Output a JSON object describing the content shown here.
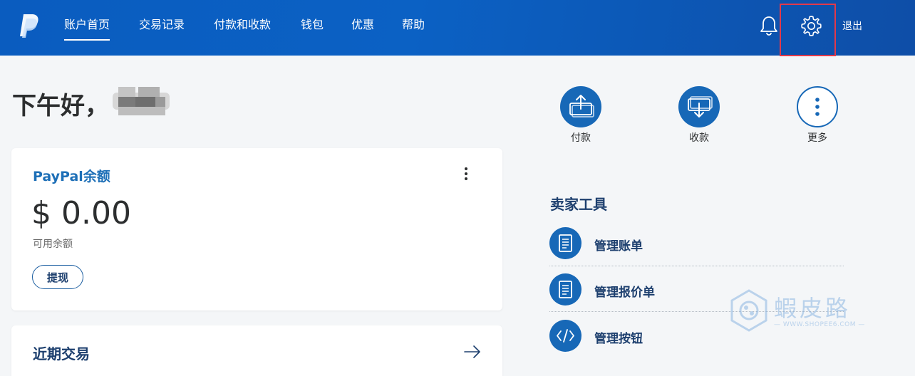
{
  "header": {
    "nav": [
      {
        "label": "账户首页",
        "active": true
      },
      {
        "label": "交易记录"
      },
      {
        "label": "付款和收款"
      },
      {
        "label": "钱包"
      },
      {
        "label": "优惠"
      },
      {
        "label": "帮助"
      }
    ],
    "logout_label": "退出"
  },
  "greeting": {
    "text": "下午好，"
  },
  "balance": {
    "title": "PayPal余额",
    "amount": "$ 0.00",
    "subtitle": "可用余额",
    "withdraw_label": "提现"
  },
  "quick_actions": [
    {
      "label": "付款",
      "icon": "send-money-icon"
    },
    {
      "label": "收款",
      "icon": "request-money-icon"
    },
    {
      "label": "更多",
      "icon": "more-vertical-icon"
    }
  ],
  "recent": {
    "title": "近期交易"
  },
  "seller_tools": {
    "title": "卖家工具",
    "items": [
      {
        "label": "管理账单",
        "icon": "invoice-icon"
      },
      {
        "label": "管理报价单",
        "icon": "quote-icon"
      },
      {
        "label": "管理按钮",
        "icon": "code-icon"
      }
    ]
  },
  "watermark": {
    "text": "蝦皮路",
    "url": "— WWW.SHOPEE6.COM —"
  },
  "colors": {
    "header_blue": "#0b61c4",
    "accent_blue": "#1768b7",
    "dark_navy": "#1d3f6e",
    "highlight_red": "#e2394a"
  }
}
